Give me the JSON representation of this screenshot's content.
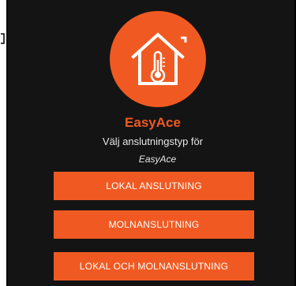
{
  "app": {
    "name": "EasyAce",
    "subtitle": "Välj anslutningstyp för",
    "subtitle_app": "EasyAce"
  },
  "buttons": {
    "local": "LOKAL ANSLUTNING",
    "cloud": "MOLNANSLUTNING",
    "both": "LOKAL OCH MOLNANSLUTNING"
  },
  "colors": {
    "accent": "#f05a22",
    "background": "#141414",
    "text": "#e6e6e6"
  },
  "icons": {
    "logo": "house-thermometer-icon"
  }
}
